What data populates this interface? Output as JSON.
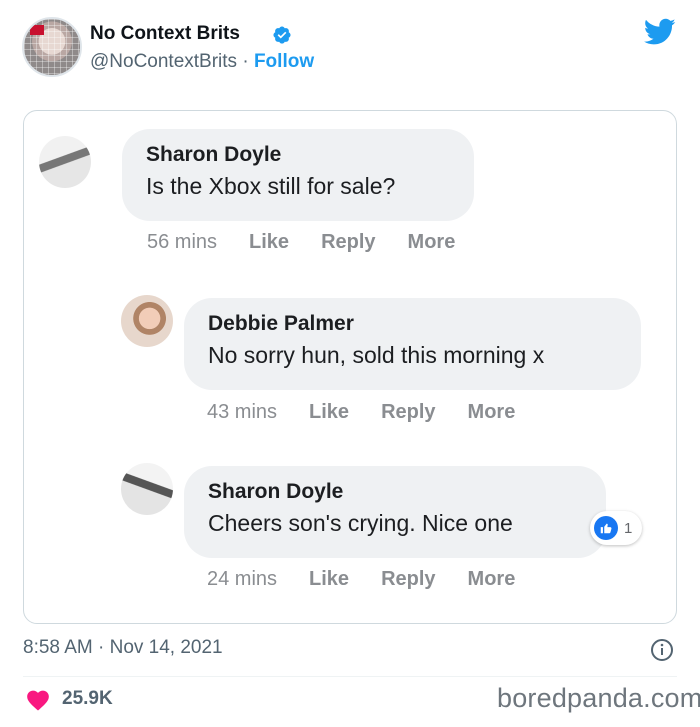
{
  "tweet": {
    "author_name": "No Context Brits",
    "author_handle": "@NoContextBrits",
    "separator": "·",
    "follow_label": "Follow",
    "timestamp": "8:58 AM · Nov 14, 2021",
    "likes": "25.9K"
  },
  "comments": [
    {
      "name": "Sharon Doyle",
      "text": "Is the Xbox still for sale?",
      "time": "56 mins",
      "like": "Like",
      "reply": "Reply",
      "more": "More"
    },
    {
      "name": "Debbie Palmer",
      "text": "No sorry hun, sold this morning x",
      "time": "43 mins",
      "like": "Like",
      "reply": "Reply",
      "more": "More"
    },
    {
      "name": "Sharon Doyle",
      "text": "Cheers son's crying. Nice one",
      "time": "24 mins",
      "like": "Like",
      "reply": "Reply",
      "more": "More",
      "reaction_count": "1"
    }
  ],
  "footer": {
    "watermark": "boredpanda.com"
  },
  "icons": {
    "verified": "verified-badge-icon",
    "platform_logo": "twitter-bird-icon",
    "info": "info-icon",
    "heart": "heart-icon",
    "reaction": "thumbs-up-icon"
  },
  "colors": {
    "accent_blue": "#1d9bf0",
    "heart_red": "#f91880",
    "facebook_blue": "#1877f2",
    "bubble_gray": "#eff1f3"
  }
}
